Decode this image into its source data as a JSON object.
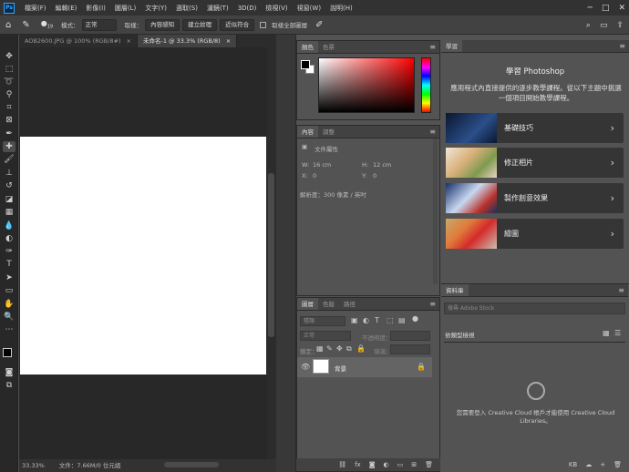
{
  "menu": {
    "items": [
      "檔案(F)",
      "編輯(E)",
      "影像(I)",
      "圖層(L)",
      "文字(Y)",
      "選取(S)",
      "濾鏡(T)",
      "3D(D)",
      "檢視(V)",
      "視窗(W)",
      "說明(H)"
    ]
  },
  "options": {
    "brush_size": "19",
    "mode_label": "模式：",
    "mode_value": "正常",
    "sample_label": "取樣：",
    "btn_content_aware": "內容感知",
    "btn_create_texture": "建立紋理",
    "btn_proximity": "近似符合",
    "sample_all_label": "取樣全部圖層"
  },
  "tabs": [
    {
      "label": "AOB2600.JPG @ 100% (RGB/8#)",
      "close": "×"
    },
    {
      "label": "未命名-1 @ 33.3% (RGB/8)",
      "close": "×"
    }
  ],
  "status": {
    "zoom": "33.33%",
    "file": "文件：7.66M/0 位元組"
  },
  "color_panel": {
    "tab_color": "顏色",
    "tab_swatches": "色票"
  },
  "properties": {
    "tab_properties": "內容",
    "tab_adjust": "調整",
    "doc_props": "文件屬性",
    "w_label": "W:",
    "w_value": "16 cm",
    "h_label": "H:",
    "h_value": "12 cm",
    "x_label": "X:",
    "x_value": "0",
    "y_label": "Y:",
    "y_value": "0",
    "resolution": "解析度：300 像素 / 英吋"
  },
  "layers": {
    "tab_layers": "圖層",
    "tab_channels": "色版",
    "tab_paths": "路徑",
    "kind_placeholder": "種類",
    "blend_mode": "正常",
    "opacity_label": "不透明度：",
    "lock_label": "鎖定：",
    "fill_label": "填滿：",
    "layer_name": "背景"
  },
  "learn": {
    "tab": "學習",
    "title": "學習 Photoshop",
    "desc": "應用程式內直接提供的逐步教學課程。從以下主題中挑選一個項目開始教學課程。",
    "cards": [
      {
        "label": "基礎技巧",
        "chevron": "›"
      },
      {
        "label": "修正相片",
        "chevron": "›"
      },
      {
        "label": "製作創意效果",
        "chevron": "›"
      },
      {
        "label": "繪圖",
        "chevron": "›"
      }
    ]
  },
  "library": {
    "tab": "資料庫",
    "search_placeholder": "搜尋 Adobe Stock",
    "group_label": "依類型檢視",
    "message": "您需要登入 Creative Cloud 帳戶才能使用 Creative Cloud Libraries。",
    "size": "KB"
  },
  "colors": {
    "accent": "#31a8ff",
    "canvas_bg": "#ffffff"
  }
}
